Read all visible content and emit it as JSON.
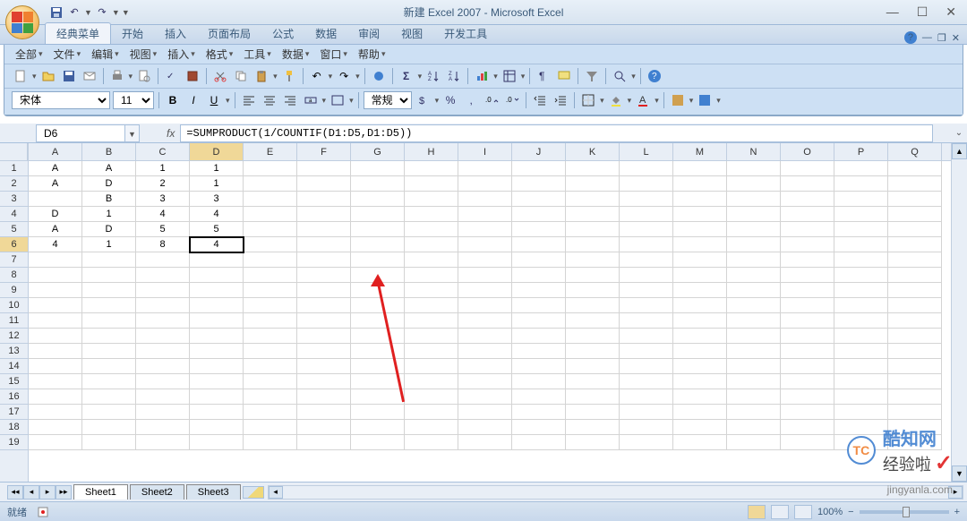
{
  "window": {
    "title": "新建 Excel 2007 - Microsoft Excel",
    "min": "—",
    "max": "☐",
    "close": "✕"
  },
  "qat": {
    "save": "💾",
    "undo": "↶",
    "redo": "↷"
  },
  "ribbon": {
    "tabs": [
      "经典菜单",
      "开始",
      "插入",
      "页面布局",
      "公式",
      "数据",
      "审阅",
      "视图",
      "开发工具"
    ],
    "active_index": 0
  },
  "menubar": {
    "items": [
      "全部",
      "文件",
      "编辑",
      "视图",
      "插入",
      "格式",
      "工具",
      "数据",
      "窗口",
      "帮助"
    ]
  },
  "toolbar2": {
    "font_name": "宋体",
    "font_size": "11",
    "number_format": "常规"
  },
  "namebox": {
    "ref": "D6"
  },
  "formula": {
    "fx": "fx",
    "text": "=SUMPRODUCT(1/COUNTIF(D1:D5,D1:D5))"
  },
  "columns": [
    "A",
    "B",
    "C",
    "D",
    "E",
    "F",
    "G",
    "H",
    "I",
    "J",
    "K",
    "L",
    "M",
    "N",
    "O",
    "P",
    "Q"
  ],
  "rows": [
    1,
    2,
    3,
    4,
    5,
    6,
    7,
    8,
    9,
    10,
    11,
    12,
    13,
    14,
    15,
    16,
    17,
    18,
    19
  ],
  "active_cell": {
    "row": 6,
    "col": "D"
  },
  "cells": {
    "A1": "A",
    "B1": "A",
    "C1": "1",
    "D1": "1",
    "A2": "A",
    "B2": "D",
    "C2": "2",
    "D2": "1",
    "B3": "B",
    "C3": "3",
    "D3": "3",
    "A4": "D",
    "B4": "1",
    "C4": "4",
    "D4": "4",
    "A5": "A",
    "B5": "D",
    "C5": "5",
    "D5": "5",
    "A6": "4",
    "B6": "1",
    "C6": "8",
    "D6": "4"
  },
  "sheets": {
    "tabs": [
      "Sheet1",
      "Sheet2",
      "Sheet3"
    ],
    "active_index": 0
  },
  "statusbar": {
    "ready": "就绪",
    "zoom": "100%",
    "zoom_minus": "−",
    "zoom_plus": "+"
  },
  "watermark": {
    "logo": "TC",
    "text": "酷知网",
    "sub": "经验啦",
    "check": "✓",
    "url": "jingyanla.com"
  }
}
